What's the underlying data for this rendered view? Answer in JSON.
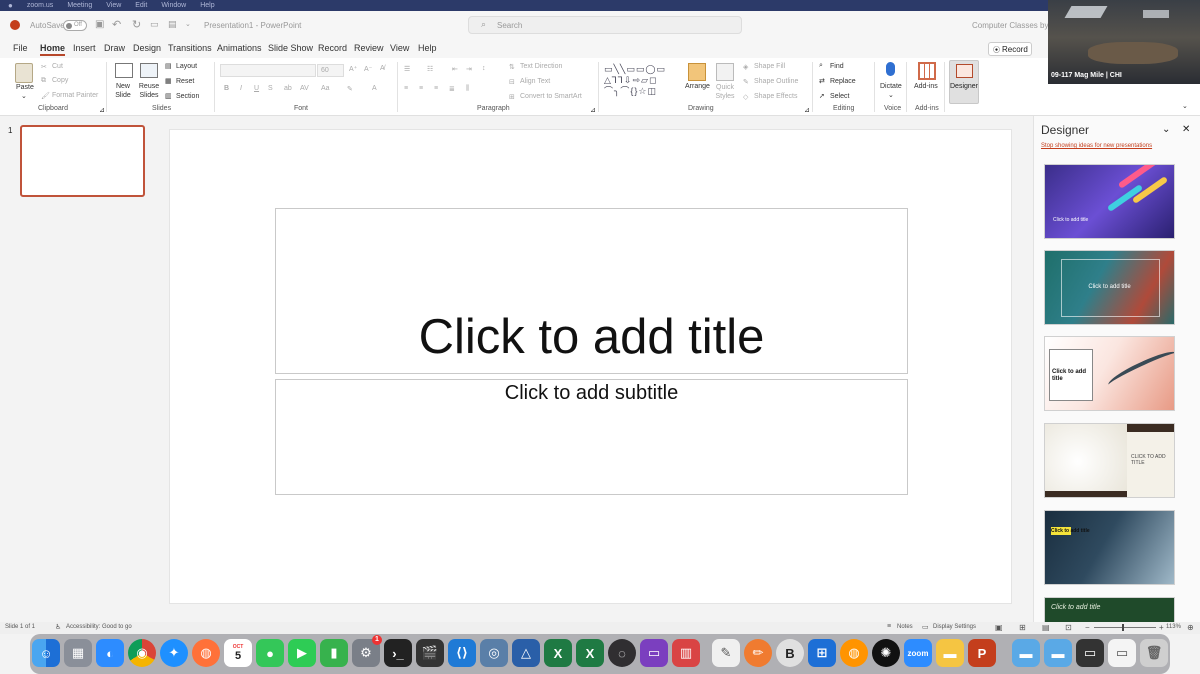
{
  "macbar": {
    "items": [
      "zoom.us",
      "Meeting",
      "View",
      "Edit",
      "Window",
      "Help"
    ]
  },
  "titlebar": {
    "autosave": "AutoSave",
    "autosave_state": "Off",
    "doc_title": "Presentation1 - PowerPoint",
    "search_placeholder": "Search",
    "account": "Computer Classes by Chi"
  },
  "tabs": [
    "File",
    "Home",
    "Insert",
    "Draw",
    "Design",
    "Transitions",
    "Animations",
    "Slide Show",
    "Record",
    "Review",
    "View",
    "Help"
  ],
  "record_button": "Record",
  "ribbon": {
    "clipboard": {
      "paste": "Paste",
      "cut": "Cut",
      "copy": "Copy",
      "format_painter": "Format Painter",
      "label": "Clipboard"
    },
    "slides": {
      "new_slide": "New Slide",
      "reuse_slides": "Reuse Slides",
      "layout": "Layout",
      "reset": "Reset",
      "section": "Section",
      "label": "Slides"
    },
    "font": {
      "size": "60",
      "label": "Font"
    },
    "paragraph": {
      "text_direction": "Text Direction",
      "align_text": "Align Text",
      "convert_smartart": "Convert to SmartArt",
      "label": "Paragraph"
    },
    "drawing": {
      "arrange": "Arrange",
      "quick_styles": "Quick Styles",
      "shape_fill": "Shape Fill",
      "shape_outline": "Shape Outline",
      "shape_effects": "Shape Effects",
      "label": "Drawing"
    },
    "editing": {
      "find": "Find",
      "replace": "Replace",
      "select": "Select",
      "label": "Editing"
    },
    "voice": {
      "dictate": "Dictate",
      "label": "Voice"
    },
    "addins": {
      "addins": "Add-ins",
      "label": "Add-ins"
    },
    "designer": {
      "designer": "Designer"
    }
  },
  "video_label": "09-117 Mag Mile | CHI",
  "thumbnail": {
    "number": "1"
  },
  "slide": {
    "title": "Click to add title",
    "subtitle": "Click to add subtitle"
  },
  "designer_pane": {
    "title": "Designer",
    "link": "Stop showing ideas for new presentations",
    "cards": [
      {
        "title": "Click to add title"
      },
      {
        "title": "Click to add title"
      },
      {
        "title": "Click to add title"
      },
      {
        "title": "CLICK TO ADD TITLE"
      },
      {
        "title": "Click to add title"
      },
      {
        "title": "Click to add title"
      }
    ]
  },
  "status": {
    "slide_count": "Slide 1 of 1",
    "accessibility": "Accessibility: Good to go",
    "notes": "Notes",
    "display_settings": "Display Settings",
    "zoom": "113%"
  },
  "dock": {
    "calendar_month": "OCT",
    "calendar_day": "5",
    "badge": "1"
  }
}
